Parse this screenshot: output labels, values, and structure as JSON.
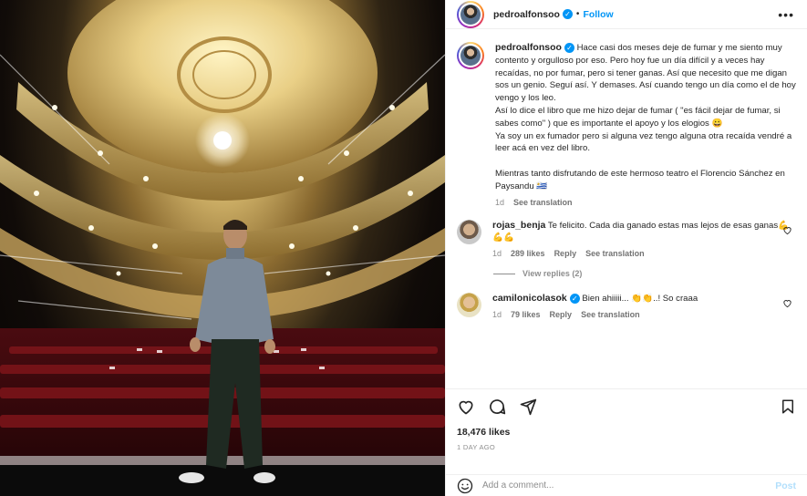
{
  "header": {
    "username": "pedroalfonsoo",
    "verified_icon": "verified-badge-icon",
    "separator": "•",
    "follow_label": "Follow",
    "more_icon": "more-options-icon",
    "more_text": "•••"
  },
  "photo": {
    "description_icon": "post-image"
  },
  "caption": {
    "username": "pedroalfonsoo",
    "lines": [
      "Hace casi dos meses deje de fumar y me siento muy contento y orgulloso por eso. Pero hoy fue un día difícil y a veces hay recaídas, no por fumar, pero si tener ganas. Así que necesito que me digan sos un genio. Seguí así. Y demases. Así cuando tengo un día como el de hoy vengo y los leo.",
      "Así lo dice el libro que me hizo dejar de fumar ( \"es fácil dejar de fumar, si sabes como\" ) que es importante el apoyo y los elogios 😀",
      "Ya soy un ex fumador pero si alguna vez tengo alguna otra recaída vendré a leer acá en vez del libro.",
      "",
      "Mientras tanto disfrutando de este hermoso teatro el Florencio Sánchez en Paysandu 🇺🇾"
    ],
    "time": "1d",
    "see_translation": "See translation"
  },
  "comments": [
    {
      "username": "rojas_benja",
      "verified": false,
      "text": "Te felicito. Cada dia ganado estas mas lejos de esas ganas💪💪💪",
      "time": "1d",
      "likes": "289 likes",
      "reply": "Reply",
      "see_translation": "See translation",
      "view_replies": "View replies (2)"
    },
    {
      "username": "camilonicolasok",
      "verified": true,
      "text": "Bien ahiiiii... 👏👏..! So craaa",
      "time": "1d",
      "likes": "79 likes",
      "reply": "Reply",
      "see_translation": "See translation"
    }
  ],
  "actions": {
    "like_icon": "heart-icon",
    "comment_icon": "comment-icon",
    "share_icon": "share-icon",
    "save_icon": "bookmark-icon",
    "likes": "18,476 likes",
    "time_ago": "1 DAY AGO"
  },
  "add_comment": {
    "emoji_icon": "emoji-icon",
    "placeholder": "Add a comment...",
    "post_label": "Post"
  },
  "colors": {
    "accent": "#0095f6",
    "muted": "#8e8e8e",
    "post_disabled": "#b2dffc"
  }
}
